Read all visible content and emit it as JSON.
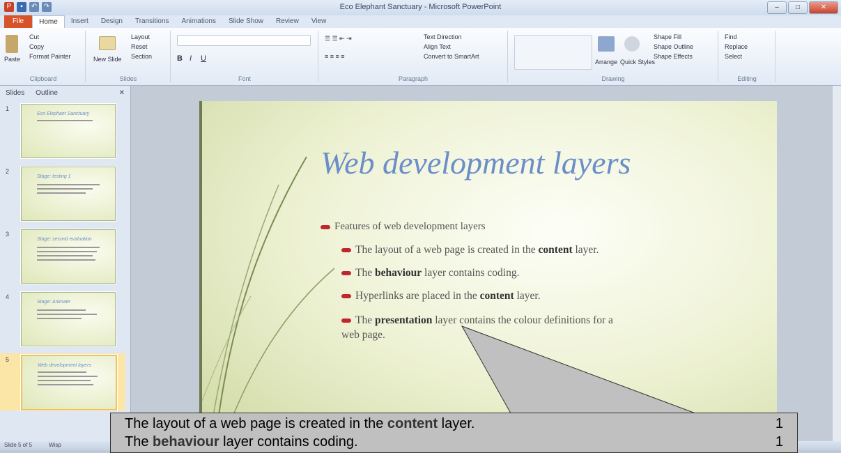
{
  "window": {
    "title": "Eco Elephant Sanctuary - Microsoft PowerPoint"
  },
  "tabs": [
    "File",
    "Home",
    "Insert",
    "Design",
    "Transitions",
    "Animations",
    "Slide Show",
    "Review",
    "View"
  ],
  "ribbon": {
    "clipboard": {
      "paste": "Paste",
      "cut": "Cut",
      "copy": "Copy",
      "format_painter": "Format Painter",
      "label": "Clipboard"
    },
    "slides": {
      "new_slide": "New Slide",
      "layout": "Layout",
      "reset": "Reset",
      "section": "Section",
      "label": "Slides"
    },
    "font": {
      "label": "Font"
    },
    "paragraph": {
      "text_direction": "Text Direction",
      "align_text": "Align Text",
      "convert_smartart": "Convert to SmartArt",
      "label": "Paragraph"
    },
    "drawing": {
      "arrange": "Arrange",
      "quick_styles": "Quick Styles",
      "shape_fill": "Shape Fill",
      "shape_outline": "Shape Outline",
      "shape_effects": "Shape Effects",
      "label": "Drawing"
    },
    "editing": {
      "find": "Find",
      "replace": "Replace",
      "select": "Select",
      "label": "Editing"
    }
  },
  "pane_tabs": [
    "Slides",
    "Outline"
  ],
  "thumbnails": [
    {
      "num": "1",
      "title": "Eco Elephant Sanctuary"
    },
    {
      "num": "2",
      "title": "Stage: testing 1"
    },
    {
      "num": "3",
      "title": "Stage: second evaluation"
    },
    {
      "num": "4",
      "title": "Stage: Animate"
    },
    {
      "num": "5",
      "title": "Web development layers"
    }
  ],
  "slide": {
    "title": "Web development layers",
    "main_bullet": "Features of web development layers",
    "sub_bullets": [
      {
        "pre": "The layout of a web page is created in the ",
        "bold": "content",
        "post": " layer."
      },
      {
        "pre": "The ",
        "bold": "behaviour",
        "post": " layer contains coding."
      },
      {
        "pre": "Hyperlinks are placed in the ",
        "bold": "content",
        "post": " layer."
      },
      {
        "pre": "The ",
        "bold": "presentation",
        "post": " layer contains the colour definitions for a web page."
      }
    ]
  },
  "statusbar": {
    "slide_info": "Slide 5 of 5",
    "theme": "Wisp"
  },
  "callout": {
    "rows": [
      {
        "pre": "The layout of a web page is created in the ",
        "bold": "content",
        "post": " layer.",
        "mark": "1"
      },
      {
        "pre": "The ",
        "bold": "behaviour",
        "post": " layer contains coding.",
        "mark": "1"
      }
    ]
  },
  "colors": {
    "file_tab": "#d7542a",
    "title_blue": "#6b8ec9",
    "bullet_red": "#c0272d",
    "callout_bg": "#c0c0c0"
  }
}
